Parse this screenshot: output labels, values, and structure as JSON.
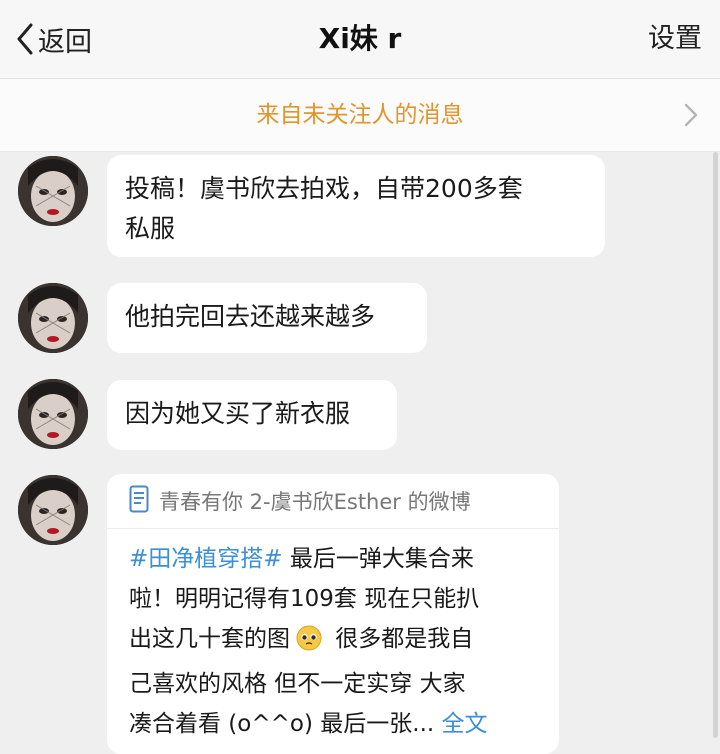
{
  "nav": {
    "back_label": "返回",
    "title": "Xi妹 r",
    "settings_label": "设置"
  },
  "notice": {
    "text": "来自未关注人的消息"
  },
  "messages": [
    {
      "text_line1": "投稿！虞书欣去拍戏，自带200多套",
      "text_line2": "私服"
    },
    {
      "text": "他拍完回去还越来越多"
    },
    {
      "text": "因为她又买了新衣服"
    }
  ],
  "shared_post": {
    "source": "青春有你 2-虞书欣Esther 的微博",
    "hashtag": "#田净植穿搭#",
    "line1_rest": " 最后一弹大集合来",
    "line2": "啦！明明记得有109套 现在只能扒",
    "line3_a": "出这几十套的图",
    "line3_b": " 很多都是我自",
    "line4": "己喜欢的风格 但不一定实穿 大家",
    "line5": "凑合着看 (o^^o) 最后一张...",
    "more_label": " 全文"
  },
  "icons": {
    "back": "chevron-left-icon",
    "notice_arrow": "chevron-right-icon",
    "source": "phone-doc-icon",
    "emoji": "pleading-face-emoji"
  },
  "colors": {
    "notice_text": "#e0952d",
    "link": "#3b8fd6",
    "background": "#efefef"
  }
}
